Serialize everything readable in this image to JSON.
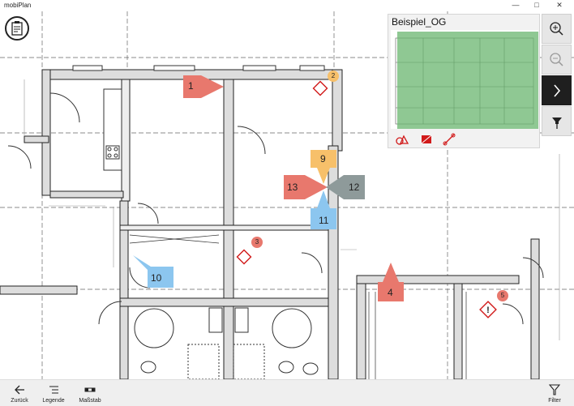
{
  "window": {
    "title": "mobiPlan",
    "min": "—",
    "max": "□",
    "close": "✕"
  },
  "minimap": {
    "title": "Beispiel_OG"
  },
  "markers": {
    "m1": "1",
    "m2": "2",
    "m3": "3",
    "m4": "4",
    "m5": "5",
    "m9": "9",
    "m10": "10",
    "m11": "11",
    "m12": "12",
    "m13": "13"
  },
  "bottombar": {
    "back": "Zurück",
    "legend": "Legende",
    "scale": "Maßstab",
    "filter": "Filter"
  },
  "colors": {
    "red": "#e8786d",
    "orange": "#f7c06a",
    "blue": "#8cc6ef",
    "gray": "#8e9a9a",
    "green": "#69b56f",
    "accent": "#d11a1a"
  }
}
